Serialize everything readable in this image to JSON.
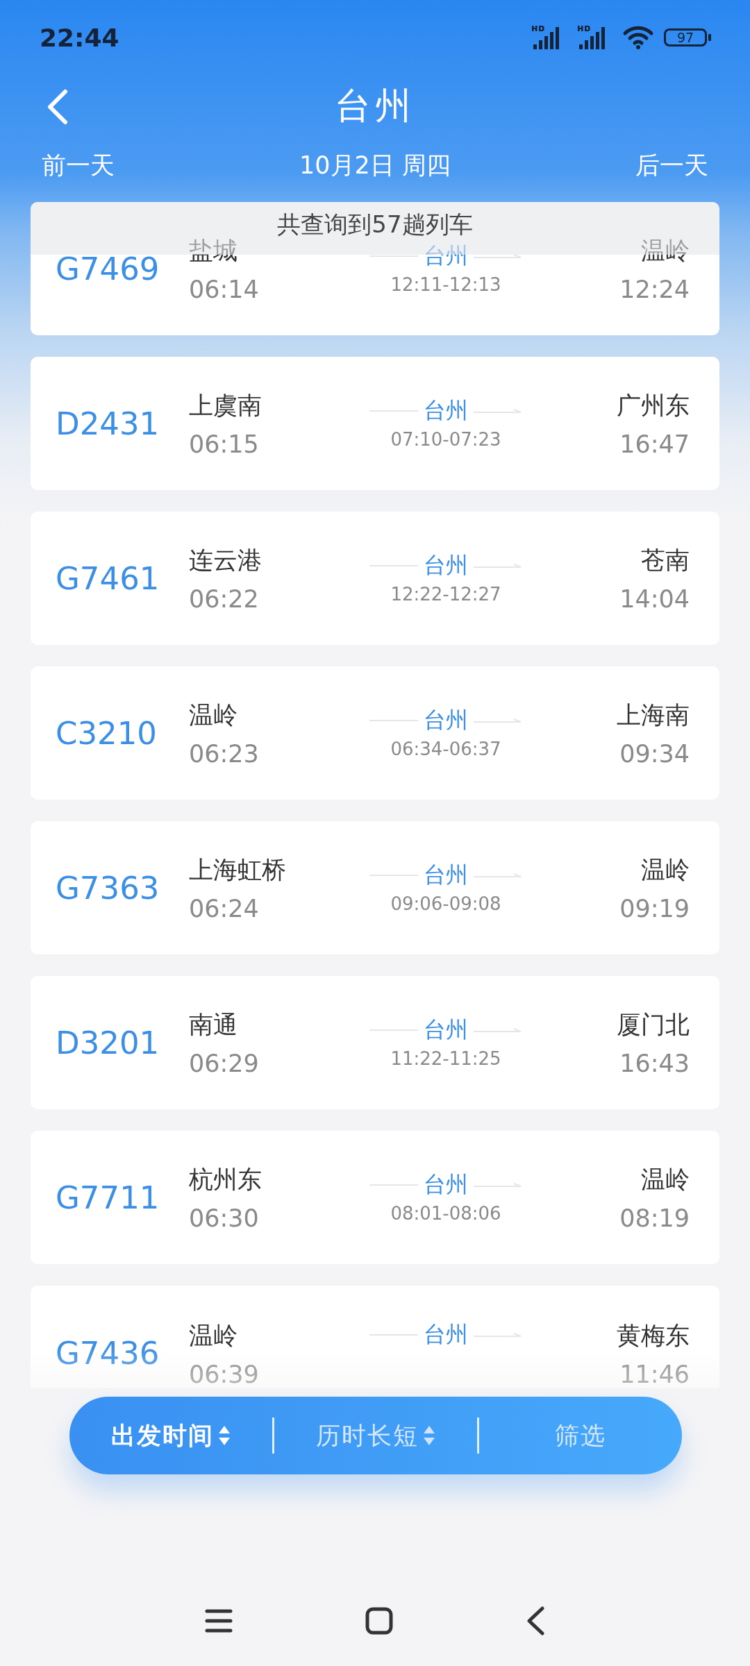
{
  "status_bar": {
    "time": "22:44",
    "battery": "97"
  },
  "header": {
    "title": "台州",
    "prev_day": "前一天",
    "date": "10月2日  周四",
    "next_day": "后一天"
  },
  "result_count": "共查询到57趟列车",
  "trains": [
    {
      "number": "G7469",
      "origin": "盐城",
      "depart": "06:14",
      "station": "台州",
      "stop_time": "12:11-12:13",
      "destination": "温岭",
      "arrive": "12:24"
    },
    {
      "number": "D2431",
      "origin": "上虞南",
      "depart": "06:15",
      "station": "台州",
      "stop_time": "07:10-07:23",
      "destination": "广州东",
      "arrive": "16:47"
    },
    {
      "number": "G7461",
      "origin": "连云港",
      "depart": "06:22",
      "station": "台州",
      "stop_time": "12:22-12:27",
      "destination": "苍南",
      "arrive": "14:04"
    },
    {
      "number": "C3210",
      "origin": "温岭",
      "depart": "06:23",
      "station": "台州",
      "stop_time": "06:34-06:37",
      "destination": "上海南",
      "arrive": "09:34"
    },
    {
      "number": "G7363",
      "origin": "上海虹桥",
      "depart": "06:24",
      "station": "台州",
      "stop_time": "09:06-09:08",
      "destination": "温岭",
      "arrive": "09:19"
    },
    {
      "number": "D3201",
      "origin": "南通",
      "depart": "06:29",
      "station": "台州",
      "stop_time": "11:22-11:25",
      "destination": "厦门北",
      "arrive": "16:43"
    },
    {
      "number": "G7711",
      "origin": "杭州东",
      "depart": "06:30",
      "station": "台州",
      "stop_time": "08:01-08:06",
      "destination": "温岭",
      "arrive": "08:19"
    },
    {
      "number": "G7436",
      "origin": "温岭",
      "depart": "06:39",
      "station": "台州",
      "destination": "黄梅东",
      "arrive": "11:46"
    }
  ],
  "sort_bar": [
    {
      "label": "出发时间",
      "arrows": true,
      "selected": true
    },
    {
      "label": "历时长短",
      "arrows": true,
      "selected": false
    },
    {
      "label": "筛选",
      "arrows": false,
      "selected": false
    }
  ]
}
